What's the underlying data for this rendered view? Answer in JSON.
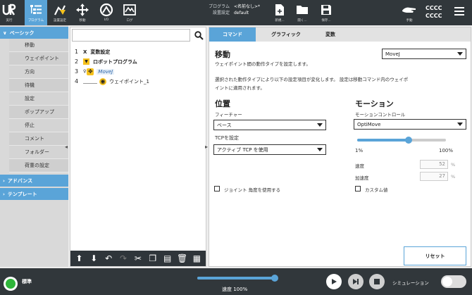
{
  "topbar": {
    "buttons": [
      {
        "label": "実行",
        "icon": "run-icon"
      },
      {
        "label": "プログラム",
        "icon": "program-icon"
      },
      {
        "label": "設置設定",
        "icon": "installation-icon"
      },
      {
        "label": "移動",
        "icon": "move-icon"
      },
      {
        "label": "I/O",
        "icon": "io-icon"
      },
      {
        "label": "ログ",
        "icon": "log-icon"
      }
    ],
    "program_key": "プログラム",
    "program_value": "<名前なし>*",
    "installation_key": "設置設定",
    "installation_value": "default",
    "file_buttons": [
      {
        "label": "新規...",
        "icon": "new-file-icon"
      },
      {
        "label": "開く...",
        "icon": "open-folder-icon"
      },
      {
        "label": "保存...",
        "icon": "save-icon"
      }
    ],
    "hand_label": "手動",
    "cccc1": "CCCC",
    "cccc2": "CCCC"
  },
  "leftnav": {
    "basic_header": "ベーシック",
    "basic_items": [
      "移動",
      "ウェイポイント",
      "方向",
      "待機",
      "設定",
      "ポップアップ",
      "停止",
      "コメント",
      "フォルダー",
      "荷重の設定"
    ],
    "advanced_header": "アドバンス",
    "template_header": "テンプレート"
  },
  "tree": {
    "rows": [
      {
        "num": "1",
        "label": "変数設定",
        "mark": "X"
      },
      {
        "num": "2",
        "label": "ロボットプログラム",
        "mark": "▼"
      },
      {
        "num": "3",
        "label": "MoveJ",
        "mark": "✥"
      },
      {
        "num": "4",
        "label": "ウェイポイント_1",
        "mark": "◉"
      }
    ]
  },
  "tabs": [
    "コマンド",
    "グラフィック",
    "変数"
  ],
  "command": {
    "title": "移動",
    "desc": "ウェイポイント間の動作タイプを設定します。",
    "move_type": "MoveJ",
    "note1": "選択された動作タイプにより以下の設定項目が変化します。 設定は移動コマンド内のウェイポ",
    "note2": "イントに適用されます。",
    "position_title": "位置",
    "feature_label": "フィーチャー",
    "feature_value": "ベース",
    "tcp_label": "TCPを設定",
    "tcp_value": "アクティブ TCP を使用",
    "joint_angle_label": "ジョイント 角度を使用する",
    "motion_title": "モーション",
    "motion_control_label": "モーションコントロール",
    "motion_control_value": "OptiMove",
    "slider_min": "1%",
    "slider_max": "100%",
    "slider_level": 0.58,
    "speed_label": "速度",
    "speed_value": "52",
    "accel_label": "加速度",
    "accel_value": "27",
    "unit": "%",
    "custom_label": "カスタム値",
    "reset_label": "リセット"
  },
  "bottom": {
    "status": "標準",
    "speed_label": "速度 100%",
    "speed_level": 1.0,
    "simulation_label": "シミュレーション"
  },
  "colors": {
    "accent": "#5aa4d8",
    "dark": "#31373b",
    "status_green": "#2fb53a"
  }
}
